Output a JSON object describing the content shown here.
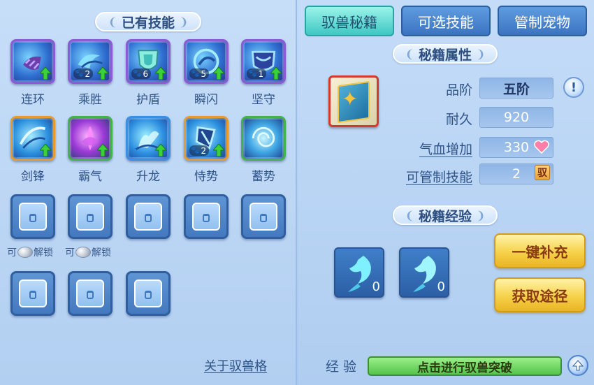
{
  "owned_skills": {
    "title": "已有技能",
    "skills": [
      {
        "name": "连环",
        "icon": "claw-skill-icon",
        "count": "",
        "upgradable": true
      },
      {
        "name": "乘胜",
        "icon": "wave-skill-icon",
        "count": "2",
        "upgradable": true
      },
      {
        "name": "护盾",
        "icon": "shield-skill-icon",
        "count": "6",
        "upgradable": true
      },
      {
        "name": "瞬闪",
        "icon": "flash-skill-icon",
        "count": "5",
        "upgradable": true
      },
      {
        "name": "坚守",
        "icon": "guard-skill-icon",
        "count": "1",
        "upgradable": true
      },
      {
        "name": "剑锋",
        "icon": "blade-skill-icon",
        "count": "",
        "upgradable": true
      },
      {
        "name": "霸气",
        "icon": "aura-skill-icon",
        "count": "",
        "upgradable": true
      },
      {
        "name": "升龙",
        "icon": "dragon-skill-icon",
        "count": "",
        "upgradable": true
      },
      {
        "name": "恃势",
        "icon": "force-skill-icon",
        "count": "2",
        "upgradable": true
      },
      {
        "name": "蓄势",
        "icon": "vortex-skill-icon",
        "count": "",
        "upgradable": false
      }
    ],
    "unlock_prefix": "可",
    "unlock_suffix": "解锁",
    "about_link": "关于驭兽格"
  },
  "tabs": [
    {
      "label": "驭兽秘籍",
      "active": true
    },
    {
      "label": "可选技能",
      "active": false
    },
    {
      "label": "管制宠物",
      "active": false
    }
  ],
  "book_attributes": {
    "title": "秘籍属性",
    "rows": [
      {
        "label": "品阶",
        "value": "五阶"
      },
      {
        "label": "耐久",
        "value": "920"
      },
      {
        "label": "气血增加",
        "value": "330"
      },
      {
        "label": "可管制技能",
        "value": "2",
        "tag": "驭"
      }
    ],
    "info_symbol": "!"
  },
  "book_experience": {
    "title": "秘籍经验",
    "items": [
      {
        "icon": "horse-spirit-icon",
        "count": "0"
      },
      {
        "icon": "horse-spirit-icon",
        "count": "0"
      }
    ],
    "refill_button": "一键补充",
    "obtain_button": "获取途径"
  },
  "experience_bar": {
    "label": "经验",
    "text": "点击进行驭兽突破"
  },
  "colors": {
    "active_tab": "#3fc7c4",
    "gold_button": "#f6d24a",
    "exp_bar": "#54c34b",
    "book_frame": "#d23a2e"
  }
}
